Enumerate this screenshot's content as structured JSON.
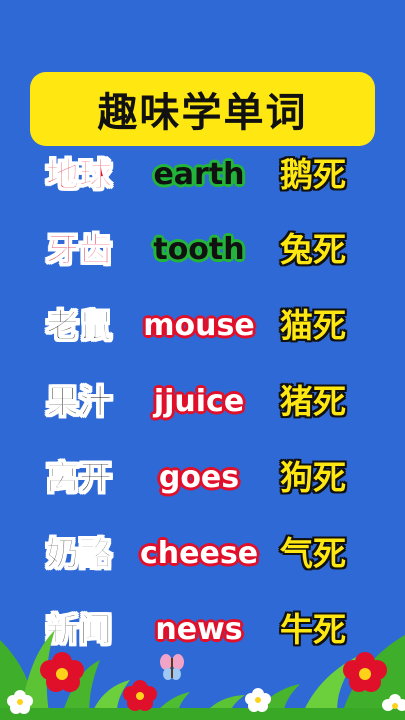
{
  "title": "趣味学单词",
  "rows": [
    {
      "cn": "地球",
      "en": "earth",
      "pun": "鹅死"
    },
    {
      "cn": "牙齿",
      "en": "tooth",
      "pun": "兔死"
    },
    {
      "cn": "老鼠",
      "en": "mouse",
      "pun": "猫死"
    },
    {
      "cn": "果汁",
      "en": "jjuice",
      "pun": "猪死"
    },
    {
      "cn": "离开",
      "en": "goes",
      "pun": "狗死"
    },
    {
      "cn": "奶酪",
      "en": "cheese",
      "pun": "气死"
    },
    {
      "cn": "新闻",
      "en": "news",
      "pun": "牛死"
    }
  ],
  "colors": {
    "background": "#2f69d6",
    "title_box": "#ffe812",
    "red": "#e0102a",
    "green": "#23b53a",
    "yellow": "#ffe812"
  },
  "decor_icons": [
    "grass-icon",
    "red-flower-icon",
    "white-flower-icon",
    "butterfly-icon"
  ]
}
